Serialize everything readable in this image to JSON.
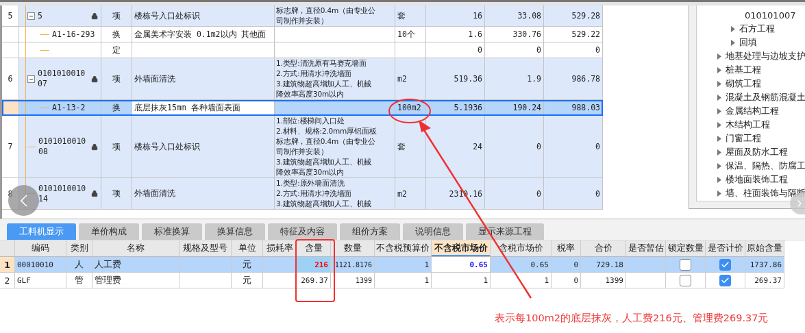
{
  "bill_table": {
    "rows": [
      {
        "kind": "item",
        "number": "5",
        "code": "5",
        "expanded": true,
        "locked": true,
        "type": "项",
        "name": "楼栋号入口处标识",
        "feature_lines": [
          "标志牌，直径0.4m（由专业公",
          "司制作并安装）"
        ],
        "unit": "套",
        "quantity": "16",
        "unit_price": "33.08",
        "total": "529.28",
        "selected": false
      },
      {
        "kind": "sub",
        "code": "A1-16-293",
        "type": "换",
        "name": "金属美术字安装 0.1m2以内 其他面",
        "unit": "10个",
        "quantity": "1.6",
        "unit_price": "330.76",
        "total": "529.22",
        "selected": false
      },
      {
        "kind": "sub",
        "type": "定",
        "quantity": "0",
        "unit_price": "0",
        "total": "0",
        "selected": false
      },
      {
        "kind": "item",
        "number": "6",
        "code": "010101001007",
        "expanded": true,
        "locked": true,
        "type": "项",
        "name": "外墙面清洗",
        "feature_lines": [
          "1.类型:清洗原有马赛克墙面",
          "2.方式:用清水冲洗墙面",
          "3.建筑物超高增加人工、机械",
          "降效率高度30m以内"
        ],
        "unit": "m2",
        "quantity": "519.36",
        "unit_price": "1.9",
        "total": "986.78",
        "selected": false
      },
      {
        "kind": "sub",
        "code": "A1-13-2",
        "type": "换",
        "name": "底层抹灰15mm 各种墙面表面",
        "unit": "100m2",
        "quantity": "5.1936",
        "unit_price": "190.24",
        "total": "988.03",
        "selected": true
      },
      {
        "kind": "item",
        "number": "7",
        "code": "010101001008",
        "expanded": false,
        "locked": true,
        "type": "项",
        "name": "楼栋号入口处标识",
        "feature_lines": [
          "1.部位:楼梯间入口处",
          "2.材料、规格:2.0mm厚铝面板",
          "标志牌，直径0.4m（由专业公",
          "司制作并安装）",
          "3.建筑物超高增加人工、机械",
          "降效率高度30m以内"
        ],
        "unit": "套",
        "quantity": "24",
        "unit_price": "0",
        "total": "0",
        "selected": false
      },
      {
        "kind": "item",
        "number": "8",
        "code": "010101001014",
        "expanded": false,
        "locked": true,
        "type": "项",
        "name": "外墙面清洗",
        "feature_lines": [
          "1.类型:原外墙面清洗",
          "2.方式:用清水冲洗墙面",
          "3.建筑物超高增加人工、机械"
        ],
        "unit": "m2",
        "quantity": "2310.16",
        "unit_price": "0",
        "total": "0",
        "selected": false
      }
    ]
  },
  "tree": {
    "items": [
      {
        "children": [
          {
            "label": "010101007",
            "kind": "leaf"
          },
          {
            "label": "石方工程",
            "kind": "branch"
          },
          {
            "label": "回填",
            "kind": "branch"
          }
        ]
      },
      {
        "label": "地基处理与边坡支护",
        "kind": "branch"
      },
      {
        "label": "桩基工程",
        "kind": "branch"
      },
      {
        "label": "砌筑工程",
        "kind": "branch"
      },
      {
        "label": "混凝土及钢筋混凝土",
        "kind": "branch"
      },
      {
        "label": "金属结构工程",
        "kind": "branch"
      },
      {
        "label": "木结构工程",
        "kind": "branch"
      },
      {
        "label": "门窗工程",
        "kind": "branch"
      },
      {
        "label": "屋面及防水工程",
        "kind": "branch"
      },
      {
        "label": "保温、隔热、防腐工",
        "kind": "branch"
      },
      {
        "label": "楼地面装饰工程",
        "kind": "branch"
      },
      {
        "label": "墙、柱面装饰与隔断",
        "kind": "branch"
      }
    ]
  },
  "tabs": [
    {
      "label": "工料机显示",
      "selected": true
    },
    {
      "label": "单价构成",
      "selected": false
    },
    {
      "label": "标准换算",
      "selected": false
    },
    {
      "label": "换算信息",
      "selected": false
    },
    {
      "label": "特征及内容",
      "selected": false
    },
    {
      "label": "组价方案",
      "selected": false
    },
    {
      "label": "说明信息",
      "selected": false
    },
    {
      "label": "显示来源工程",
      "selected": false
    }
  ],
  "resource_table": {
    "columns": [
      {
        "label": "编码",
        "active": false
      },
      {
        "label": "类别",
        "active": false
      },
      {
        "label": "名称",
        "active": false
      },
      {
        "label": "规格及型号",
        "active": false
      },
      {
        "label": "单位",
        "active": false
      },
      {
        "label": "损耗率",
        "active": false
      },
      {
        "label": "含量",
        "active": false
      },
      {
        "label": "数量",
        "active": false
      },
      {
        "label": "不含税预算价",
        "active": false
      },
      {
        "label": "不含税市场价",
        "active": true
      },
      {
        "label": "含税市场价",
        "active": false
      },
      {
        "label": "税率",
        "active": false
      },
      {
        "label": "合价",
        "active": false
      },
      {
        "label": "是否暂估",
        "active": false
      },
      {
        "label": "锁定数量",
        "active": false
      },
      {
        "label": "是否计价",
        "active": false
      },
      {
        "label": "原始含量",
        "active": false
      }
    ],
    "rows": [
      {
        "number": "1",
        "selected": true,
        "content_changed": true,
        "code": "00010010",
        "category": "人",
        "name": "人工费",
        "unit": "元",
        "content": "216",
        "quantity": "1121.8176",
        "budget_price": "1",
        "market_price": "0.65",
        "tax_market_price": "0.65",
        "tax_rate": "0",
        "total": "729.18",
        "lock_quantity": false,
        "priced": true,
        "original_content": "1737.86"
      },
      {
        "number": "2",
        "selected": false,
        "content_changed": false,
        "code": "GLF",
        "category": "管",
        "name": "管理费",
        "unit": "元",
        "content": "269.37",
        "quantity": "1399",
        "budget_price": "1",
        "market_price": "1",
        "tax_market_price": "1",
        "tax_rate": "0",
        "total": "1399",
        "lock_quantity": false,
        "priced": true,
        "original_content": "269.37"
      }
    ]
  },
  "annotation": {
    "note": "表示每100m2的底层抹灰，人工费216元、管理费269.37元"
  }
}
